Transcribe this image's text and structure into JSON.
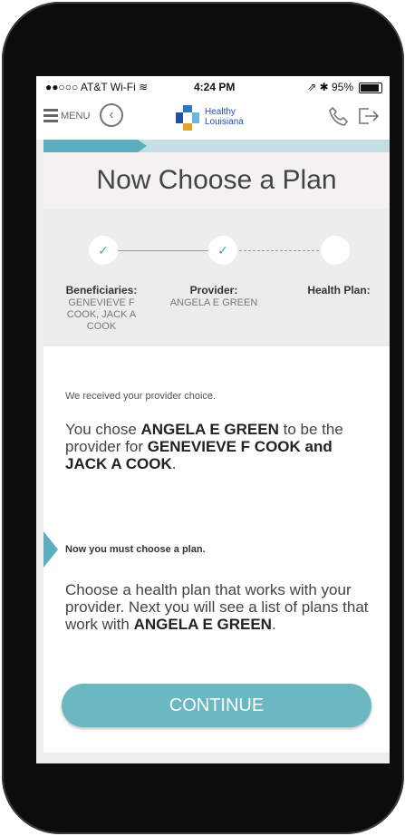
{
  "status_bar": {
    "carrier": "●●○○○ AT&T Wi-Fi ≋",
    "time": "4:24 PM",
    "battery": "⇗ ✱ 95%"
  },
  "app_bar": {
    "menu_label": "MENU",
    "logo_line1": "Healthy",
    "logo_line2": "Louisiana"
  },
  "page": {
    "title": "Now Choose a Plan"
  },
  "steps": [
    {
      "label": "Beneficiaries:",
      "value": "GENEVIEVE F COOK, JACK A COOK",
      "completed": true
    },
    {
      "label": "Provider:",
      "value": "ANGELA E GREEN",
      "completed": true
    },
    {
      "label": "Health Plan:",
      "value": "",
      "completed": false
    }
  ],
  "content": {
    "received": "We received your provider choice.",
    "chosen_pre": "You chose ",
    "provider_name": "ANGELA E GREEN",
    "chosen_mid": " to be the provider for ",
    "beneficiaries": "GENEVIEVE F COOK and JACK A COOK",
    "chosen_end": ".",
    "now_must": "Now you must choose a plan.",
    "choose_text": "Choose a health plan that works with your provider. Next you will see a list of plans that work with ",
    "choose_provider": "ANGELA E GREEN",
    "choose_end": "."
  },
  "continue_label": "CONTINUE",
  "colors": {
    "accent": "#5baebf",
    "button": "#6bb8c3",
    "logo_blue": "#1f4fa8",
    "logo_orange": "#e1a229"
  },
  "icons": {
    "back": "chevron-left-circle-icon",
    "phone": "phone-icon",
    "logout": "logout-icon",
    "check": "check-icon"
  }
}
